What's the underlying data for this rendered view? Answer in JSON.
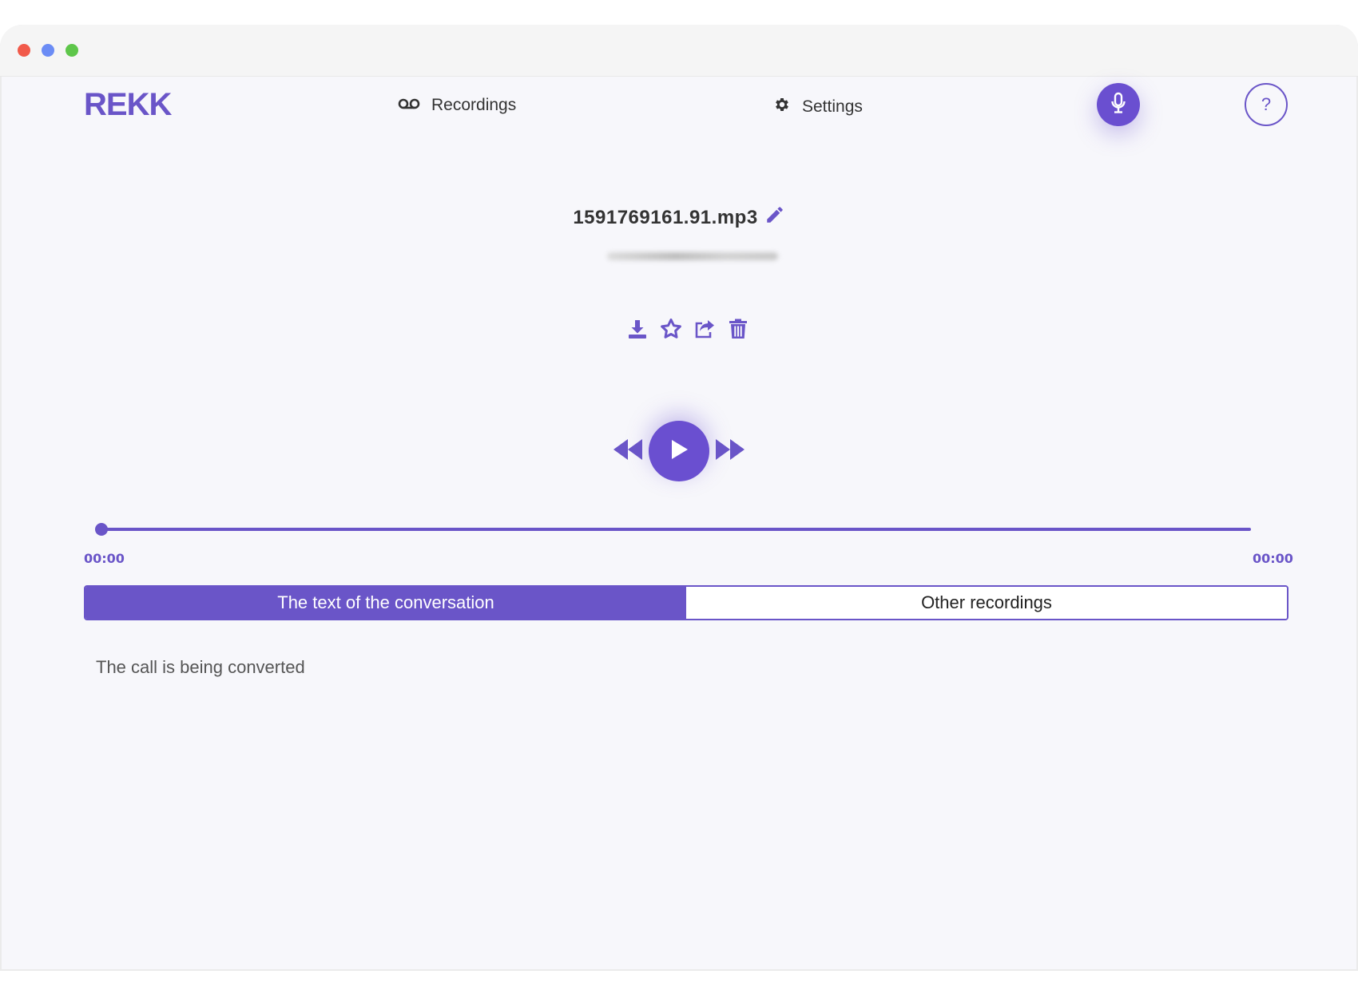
{
  "window": {
    "controls": [
      "close",
      "minimize",
      "maximize"
    ]
  },
  "header": {
    "logo": "REKK",
    "nav": {
      "recordings_label": "Recordings",
      "settings_label": "Settings"
    },
    "help_label": "?"
  },
  "recording": {
    "filename": "1591769161.91.mp3",
    "actions": [
      "download-icon",
      "star-icon",
      "share-icon",
      "trash-icon"
    ]
  },
  "player": {
    "current_time": "00:00",
    "total_time": "00:00",
    "progress": 0
  },
  "tabs": [
    {
      "label": "The text of the conversation",
      "active": true
    },
    {
      "label": "Other recordings",
      "active": false
    }
  ],
  "content": {
    "status": "The call is being converted"
  },
  "colors": {
    "accent": "#6a55c8",
    "background": "#f7f7fb"
  }
}
